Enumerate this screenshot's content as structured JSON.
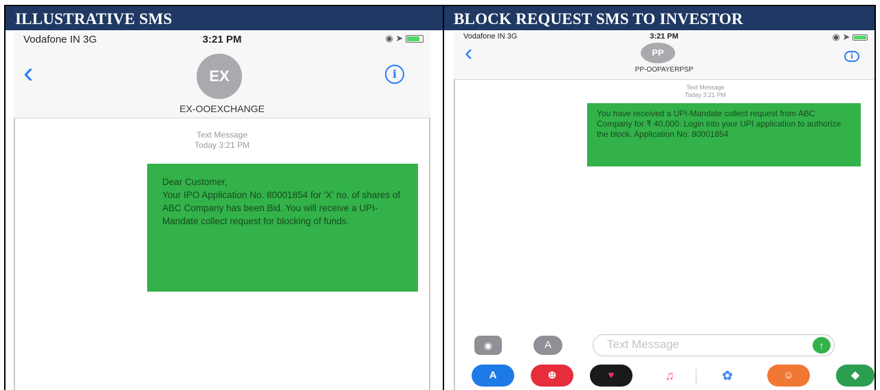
{
  "panels": [
    {
      "header": "ILLUSTRATIVE SMS",
      "status": {
        "carrier": "Vodafone IN  3G",
        "time": "3:21 PM"
      },
      "avatar": "EX",
      "sender": "EX-OOEXCHANGE",
      "meta_label": "Text Message",
      "meta_time": "Today 3:21 PM",
      "message": "Dear Customer,\nYour IPO Application No. 80001854 for 'X' no. of shares of ABC Company has been Bid. You will receive a UPI-Mandate collect request for blocking of funds."
    },
    {
      "header": "BLOCK REQUEST SMS TO INVESTOR",
      "status": {
        "carrier": "Vodafone IN  3G",
        "time": "3:21 PM"
      },
      "avatar": "PP",
      "sender": "PP-OOPAYERPSP",
      "meta_label": "Text Message",
      "meta_time": "Today 3:21 PM",
      "message": "You have received a UPI-Mandate collect request from ABC Company for ₹ 40,000. Login into your UPI application to authorize the block. Application No: 80001854",
      "compose_placeholder": "Text Message"
    }
  ],
  "colors": {
    "header_bg": "#1f3864",
    "bubble": "#33b24a",
    "ios_blue": "#2a7bf6"
  }
}
